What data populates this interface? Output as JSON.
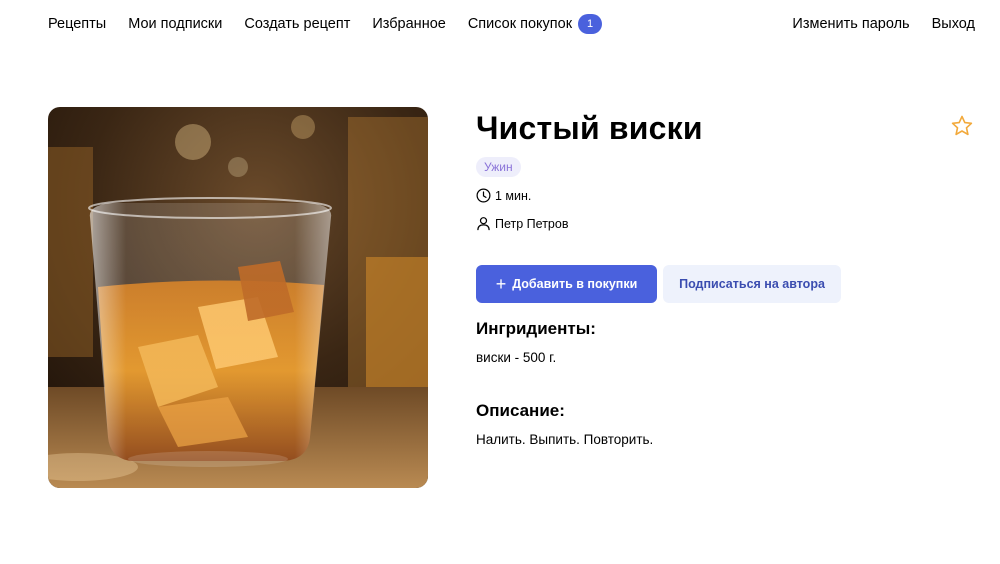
{
  "nav": {
    "left": [
      "Рецепты",
      "Мои подписки",
      "Создать рецепт",
      "Избранное"
    ],
    "cart_label": "Список покупок",
    "cart_count": "1",
    "change_password": "Изменить пароль",
    "logout": "Выход"
  },
  "recipe": {
    "title": "Чистый виски",
    "tag": "Ужин",
    "time": "1 мин.",
    "author": "Петр Петров",
    "add_to_cart": "Добавить в покупки",
    "subscribe": "Подписаться на автора",
    "ingredients_title": "Ингридиенты:",
    "ingredients": "виски - 500 г.",
    "description_title": "Описание:",
    "description": "Налить. Выпить. Повторить."
  },
  "colors": {
    "accent": "#4a61dd",
    "tag_bg": "#eeeefb",
    "tag_text": "#8a73d8",
    "star": "#f2a93b"
  }
}
